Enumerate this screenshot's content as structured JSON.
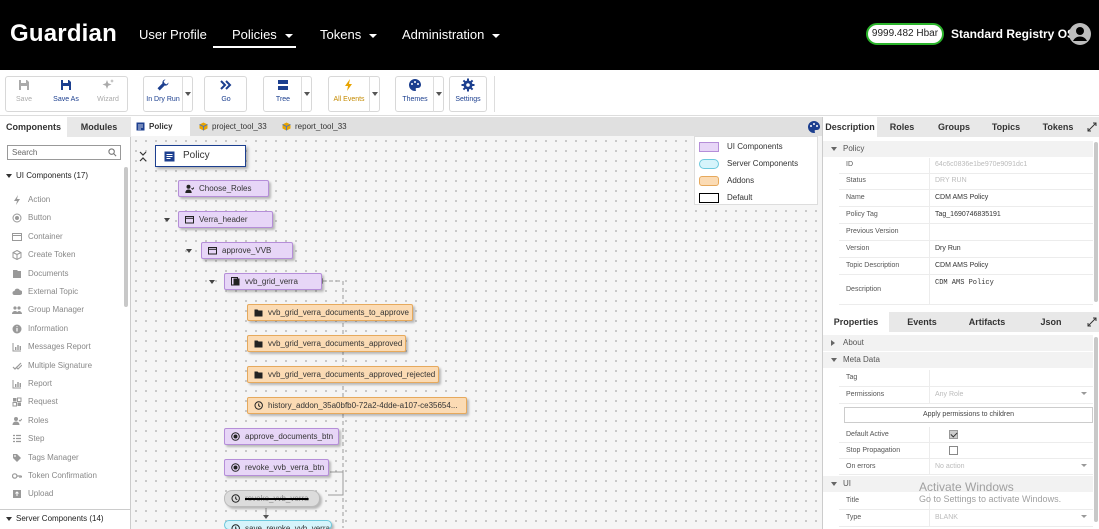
{
  "app": {
    "logo": "Guardian",
    "nav": [
      {
        "label": "User Profile"
      },
      {
        "label": "Policies"
      },
      {
        "label": "Tokens"
      },
      {
        "label": "Administration"
      }
    ],
    "balance": "9999.482 Hbar",
    "role": "Standard Registry OS"
  },
  "toolbar": {
    "save": "Save",
    "save_as": "Save As",
    "wizard": "Wizard",
    "dry_run": "In Dry Run",
    "go": "Go",
    "tree": "Tree",
    "all_events": "All Events",
    "themes": "Themes",
    "settings": "Settings"
  },
  "left": {
    "tabs": [
      "Components",
      "Modules"
    ],
    "search_placeholder": "Search",
    "ui_group": "UI Components (17)",
    "server_group": "Server Components (14)",
    "components": [
      {
        "label": "Action",
        "icon": "lightning-icon"
      },
      {
        "label": "Button",
        "icon": "radio-icon"
      },
      {
        "label": "Container",
        "icon": "container-icon"
      },
      {
        "label": "Create Token",
        "icon": "cube-icon"
      },
      {
        "label": "Documents",
        "icon": "documents-icon"
      },
      {
        "label": "External Topic",
        "icon": "cloud-icon"
      },
      {
        "label": "Group Manager",
        "icon": "group-icon"
      },
      {
        "label": "Information",
        "icon": "info-icon"
      },
      {
        "label": "Messages Report",
        "icon": "report-icon"
      },
      {
        "label": "Multiple Signature",
        "icon": "signature-icon"
      },
      {
        "label": "Report",
        "icon": "report-icon"
      },
      {
        "label": "Request",
        "icon": "request-icon"
      },
      {
        "label": "Roles",
        "icon": "roles-icon"
      },
      {
        "label": "Step",
        "icon": "step-icon"
      },
      {
        "label": "Tags Manager",
        "icon": "tag-icon"
      },
      {
        "label": "Token Confirmation",
        "icon": "key-icon"
      },
      {
        "label": "Upload",
        "icon": "upload-icon"
      }
    ]
  },
  "canvas": {
    "tabs": [
      "Policy",
      "project_tool_33",
      "report_tool_33"
    ],
    "policy_node": "Policy",
    "nodes": [
      {
        "label": "Choose_Roles"
      },
      {
        "label": "Verra_header"
      },
      {
        "label": "approve_VVB"
      },
      {
        "label": "vvb_grid_verra"
      },
      {
        "label": "vvb_grid_verra_documents_to_approve"
      },
      {
        "label": "vvb_grid_verra_documents_approved"
      },
      {
        "label": "vvb_grid_verra_documents_approved_rejected"
      },
      {
        "label": "history_addon_35a0bfb0-72a2-4dde-a107-ce35654..."
      },
      {
        "label": "approve_documents_btn"
      },
      {
        "label": "revoke_vvb_verra_btn"
      },
      {
        "label": "revoke_vvb_verra"
      },
      {
        "label": "save_revoke_vvb_verra"
      }
    ],
    "legend": [
      {
        "label": "UI Components",
        "color": "#e7d6f7",
        "border": "#b58ed8"
      },
      {
        "label": "Server Components",
        "color": "#d6f4fb",
        "border": "#6cc9dd"
      },
      {
        "label": "Addons",
        "color": "#fbdbb4",
        "border": "#e6a95c"
      },
      {
        "label": "Default",
        "color": "#ffffff",
        "border": "#000000"
      }
    ]
  },
  "right": {
    "top_tabs": [
      "Description",
      "Roles",
      "Groups",
      "Topics",
      "Tokens"
    ],
    "policy_section": "Policy",
    "policy_rows": [
      {
        "k": "ID",
        "v": "64c6c0836e1be970e9091dc1"
      },
      {
        "k": "Status",
        "v": "DRY RUN"
      },
      {
        "k": "Name",
        "v": "CDM AMS Policy"
      },
      {
        "k": "Policy Tag",
        "v": "Tag_1690746835191"
      },
      {
        "k": "Previous Version",
        "v": ""
      },
      {
        "k": "Version",
        "v": "Dry Run"
      },
      {
        "k": "Topic Description",
        "v": "CDM AMS Policy"
      },
      {
        "k": "Description",
        "v": "CDM AMS Policy"
      }
    ],
    "bottom_tabs": [
      "Properties",
      "Events",
      "Artifacts",
      "Json"
    ],
    "about": "About",
    "meta": "Meta Data",
    "tag_label": "Tag",
    "permissions_label": "Permissions",
    "permissions_value": "Any Role",
    "apply_btn": "Apply permissions to children",
    "default_active": "Default Active",
    "stop_propagation": "Stop Propagation",
    "on_errors": "On errors",
    "on_errors_value": "No action",
    "ui_section": "UI",
    "title_label": "Title",
    "type_label": "Type",
    "type_value": "BLANK"
  },
  "watermark": {
    "line1": "Activate Windows",
    "line2": "Go to Settings to activate Windows."
  },
  "colors": {
    "ui": "#e7d6f7",
    "addon": "#fbdbb4",
    "server": "#d6f4fb",
    "accent": "#1c3f8f",
    "balance_border": "#2ab32a"
  }
}
